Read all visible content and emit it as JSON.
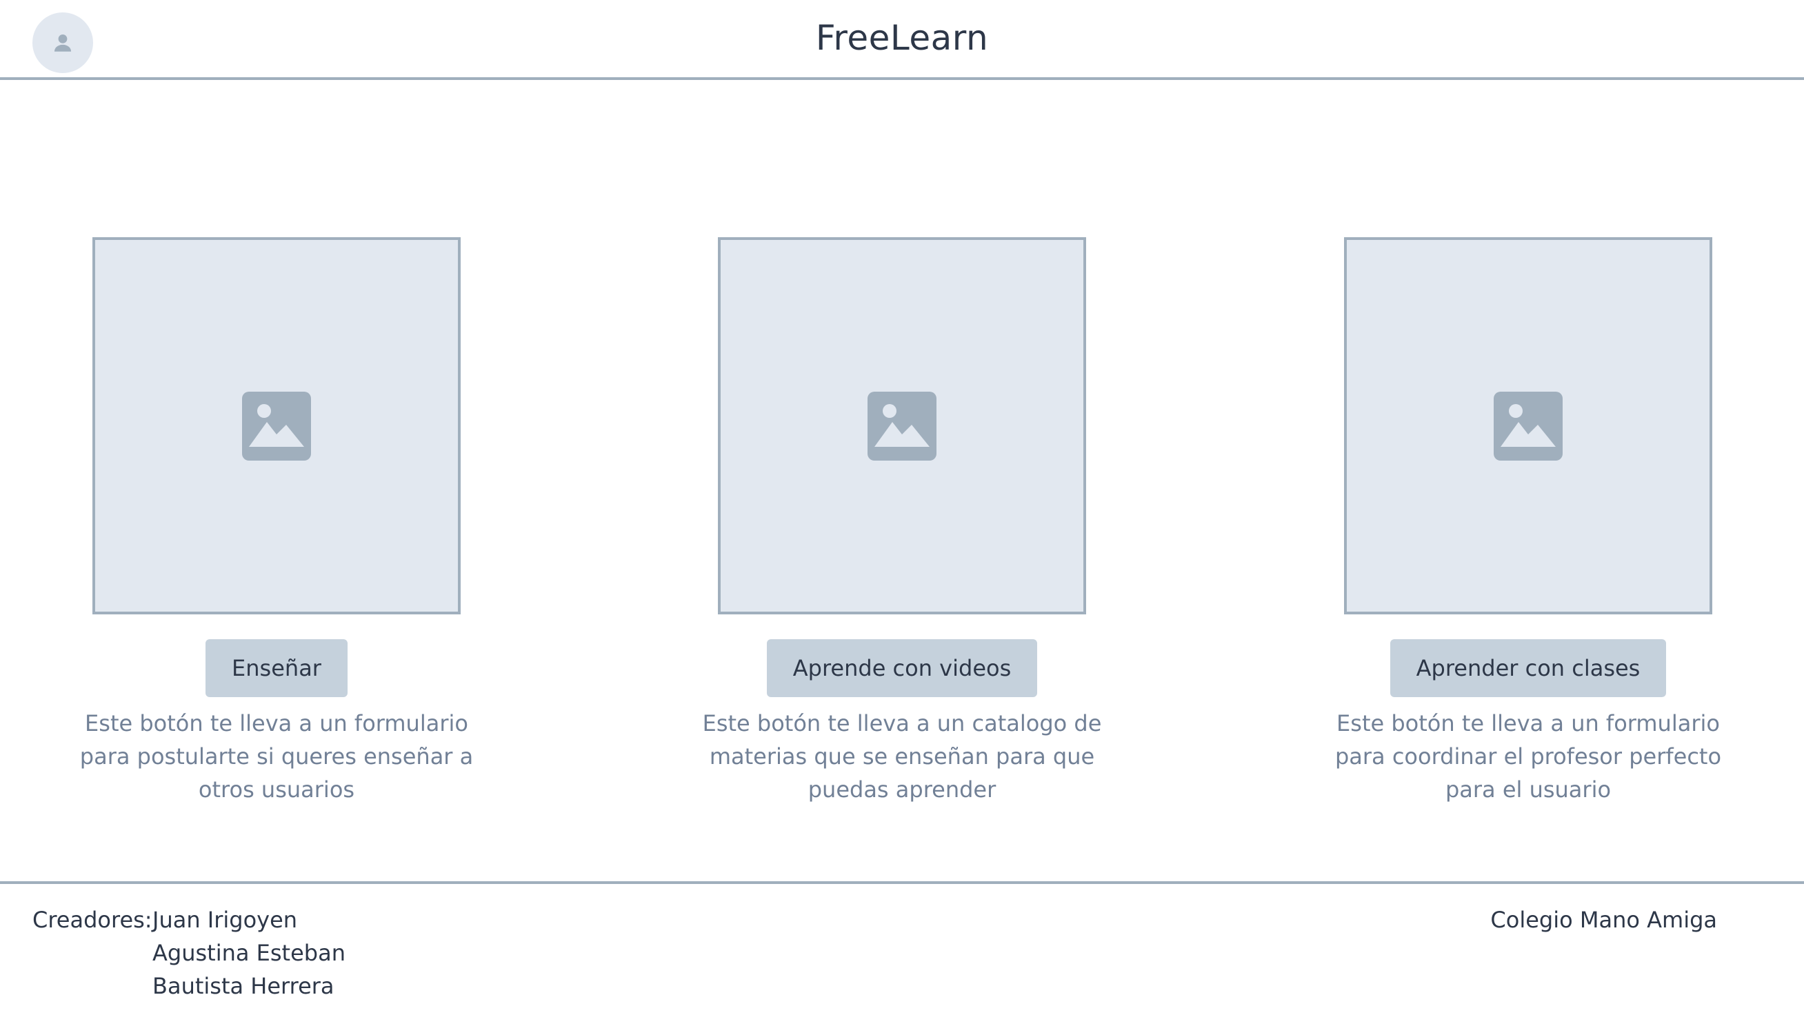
{
  "header": {
    "title": "FreeLearn",
    "avatar_icon": "user-icon"
  },
  "cards": [
    {
      "image_icon": "image-placeholder-icon",
      "button_label": "Enseñar",
      "description": "Este botón te lleva a un formulario para postularte si queres enseñar a otros usuarios"
    },
    {
      "image_icon": "image-placeholder-icon",
      "button_label": "Aprende con videos",
      "description": "Este botón te lleva a un catalogo de materias que se enseñan para que puedas aprender"
    },
    {
      "image_icon": "image-placeholder-icon",
      "button_label": "Aprender con clases",
      "description": "Este botón te lleva a un formulario para coordinar el profesor perfecto para el usuario"
    }
  ],
  "footer": {
    "creators_label": "Creadores:",
    "creators": [
      "Juan Irigoyen",
      "Agustina Esteban",
      "Bautista Herrera"
    ],
    "school": "Colegio Mano Amiga"
  },
  "colors": {
    "border": "#a0afbd",
    "placeholder_bg": "#e2e8f0",
    "button_bg": "#c5d1dc",
    "text_dark": "#2d3748",
    "text_muted": "#718096"
  }
}
